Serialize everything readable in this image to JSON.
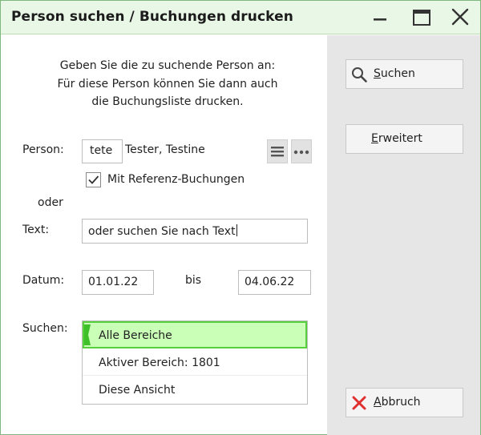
{
  "window": {
    "title": "Person suchen / Buchungen drucken"
  },
  "instructions": {
    "line1": "Geben Sie die zu suchende Person an:",
    "line2": "Für diese Person können Sie dann auch",
    "line3": "die Buchungsliste drucken."
  },
  "person": {
    "label": "Person:",
    "code_value": "tete",
    "name": "Tester, Testine"
  },
  "referenz": {
    "label": "Mit Referenz-Buchungen",
    "checked": true
  },
  "oder_label": "oder",
  "text_search": {
    "label": "Text:",
    "value": "oder suchen Sie nach Text"
  },
  "date": {
    "label": "Datum:",
    "from": "01.01.22",
    "between_label": "bis",
    "to": "04.06.22"
  },
  "scope": {
    "label": "Suchen:",
    "options": [
      "Alle Bereiche",
      "Aktiver Bereich: 1801",
      "Diese Ansicht"
    ],
    "selected": "Alle Bereiche"
  },
  "buttons": {
    "search_mnemonic": "S",
    "search_rest": "uchen",
    "extended_mnemonic": "E",
    "extended_rest": "rweitert",
    "cancel_mnemonic": "A",
    "cancel_rest": "bbruch"
  },
  "icons": {
    "search": "magnifier-icon",
    "cancel": "red-x-icon",
    "list": "hamburger-list-icon",
    "more": "ellipsis-icon",
    "minimize": "minimize-icon",
    "maximize": "maximize-icon",
    "close": "close-icon"
  },
  "colors": {
    "titlebar_bg": "#e9f8e6",
    "selected_bg": "#c9ffb6",
    "selected_border": "#55d03c",
    "cancel_icon": "#e03030",
    "side_panel": "#e6e6e6"
  }
}
